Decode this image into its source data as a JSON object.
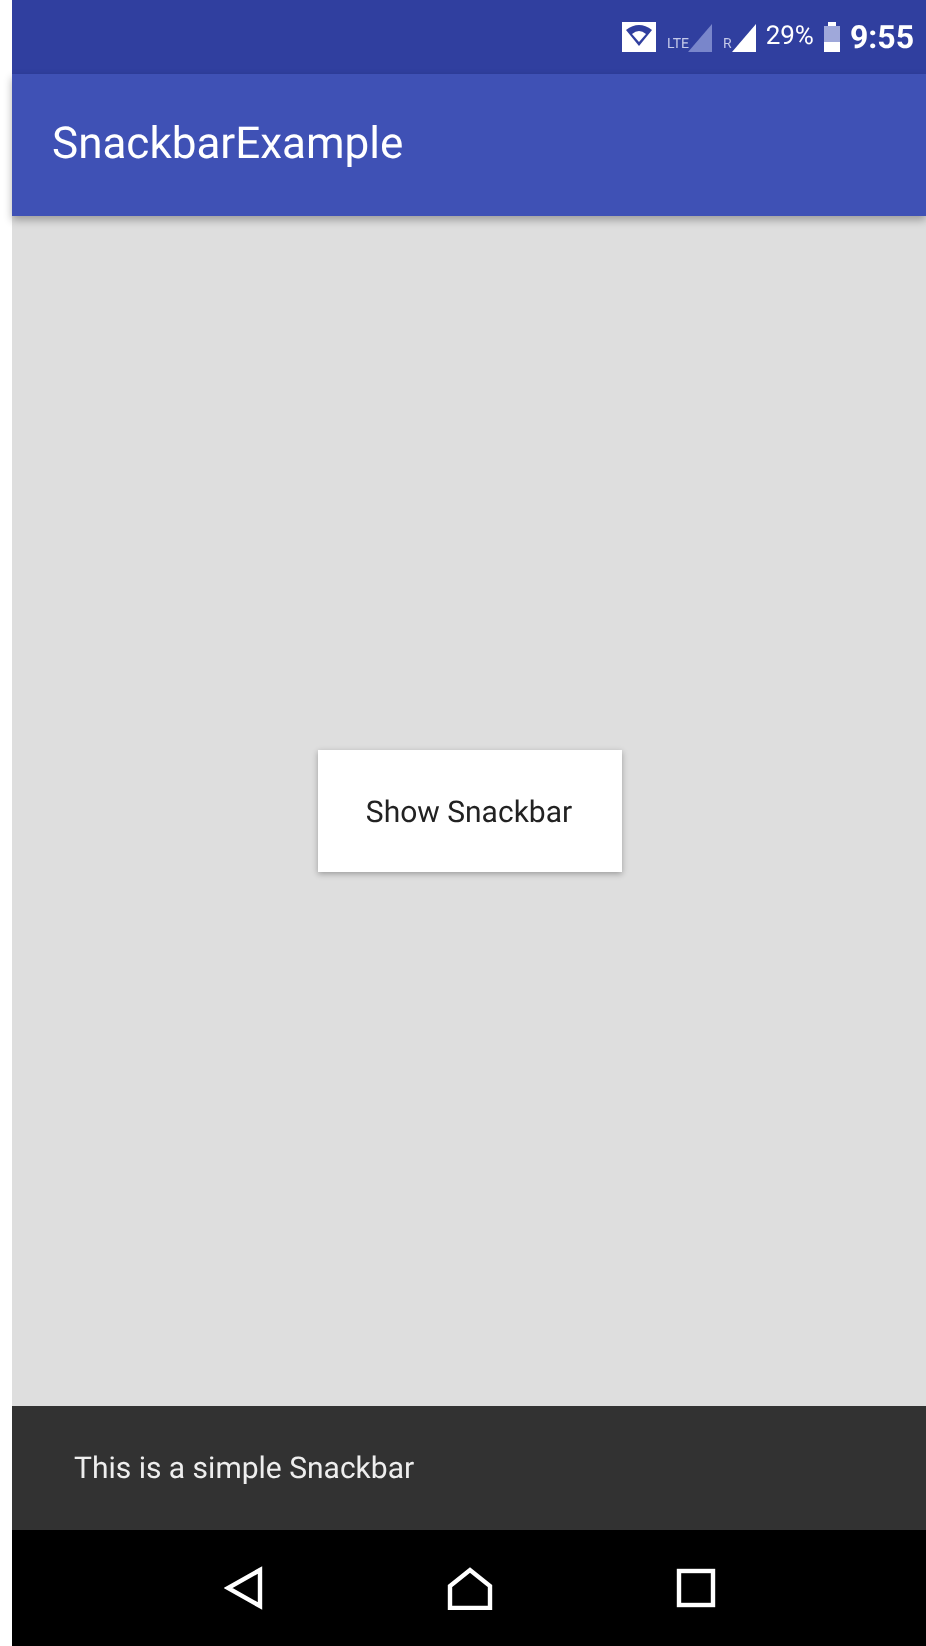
{
  "status_bar": {
    "lte_label": "LTE",
    "roaming_label": "R",
    "battery": "29%",
    "time": "9:55"
  },
  "app_bar": {
    "title": "SnackbarExample"
  },
  "button": {
    "label": "Show Snackbar"
  },
  "snackbar": {
    "message": "This is a simple Snackbar"
  }
}
